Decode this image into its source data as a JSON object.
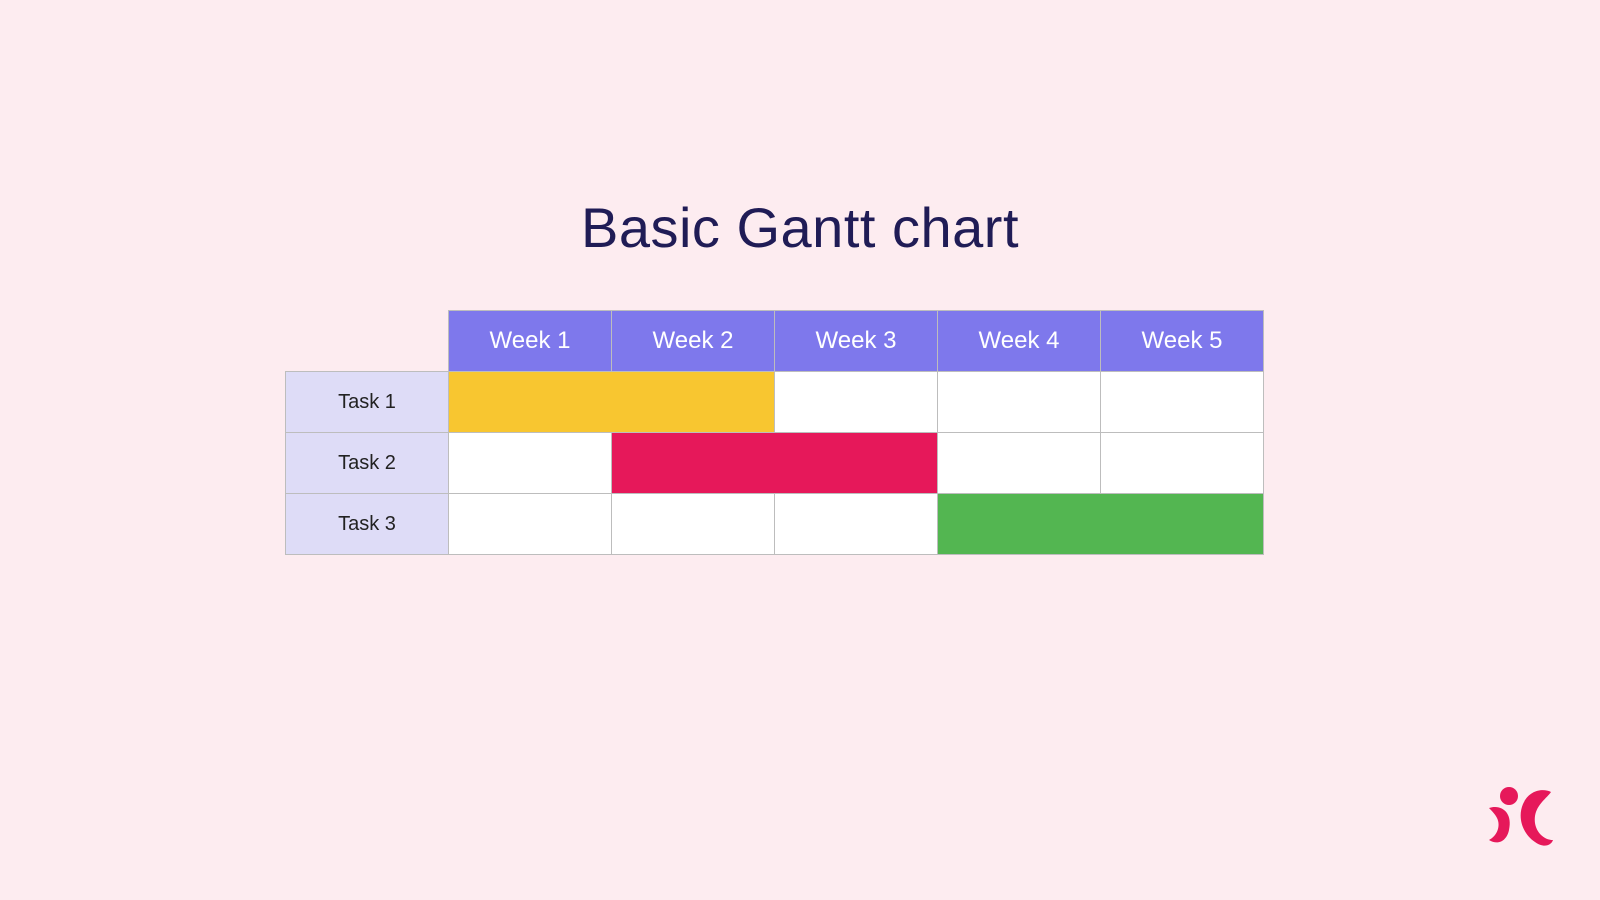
{
  "title": "Basic Gantt chart",
  "colors": {
    "page_bg": "#fdecf0",
    "title_text": "#201c56",
    "header_bg": "#7e78ec",
    "header_text": "#ffffff",
    "task_label_bg": "#dedcf7",
    "cell_bg": "#ffffff",
    "cell_border": "#bdbdbd",
    "logo": "#e6185a"
  },
  "chart_data": {
    "type": "bar",
    "orientation": "gantt",
    "categories": [
      "Week 1",
      "Week 2",
      "Week 3",
      "Week 4",
      "Week 5"
    ],
    "series": [
      {
        "name": "Task 1",
        "start": 1,
        "end": 2,
        "color": "#f8c630"
      },
      {
        "name": "Task 2",
        "start": 2,
        "end": 3,
        "color": "#e6185a"
      },
      {
        "name": "Task 3",
        "start": 4,
        "end": 5,
        "color": "#53b651"
      }
    ],
    "title": "Basic Gantt chart",
    "xlabel": "",
    "ylabel": ""
  }
}
